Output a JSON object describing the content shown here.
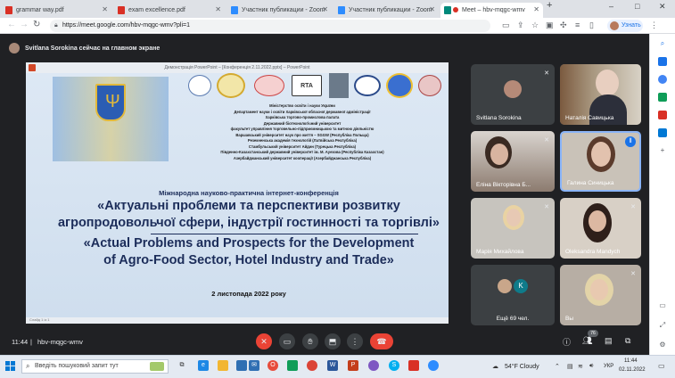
{
  "browser": {
    "tabs": [
      {
        "title": "grammar way.pdf",
        "color": "#d93025"
      },
      {
        "title": "exam excellence.pdf",
        "color": "#d93025"
      },
      {
        "title": "Участник публикации - Zoom",
        "color": "#2d8cff"
      },
      {
        "title": "Участник публикации - Zoom",
        "color": "#2d8cff"
      },
      {
        "title": "Meet – hbv-mqgc-wmv",
        "color": "#00897b"
      }
    ],
    "new_tab": "+",
    "url": "https://meet.google.com/hbv-mqgc-wmv?pli=1",
    "update_label": "Узнать",
    "window_controls": [
      "–",
      "□",
      "✕"
    ]
  },
  "meet": {
    "banner": "Svitlana Sorokina сейчас на главном экране",
    "ppt_title": "Демонстрація PowerPoint – [Конференція 2.11.2022.pptx] – PowerPoint",
    "slide_footer": "Слайд 1 із 1",
    "slide": {
      "org_lines": [
        "Міністерство освіти і науки України",
        "Департамент науки і освіти Харківської обласної державної адміністрації",
        "Харківська торгово-промислова палата",
        "Державний біотехнологічний університет",
        "факультет управління торговельно-підприємницькою та митною діяльністю",
        "Варшавський університет наук про життя – SGGW (Республіка Польща)",
        "Резекненська академія технологій (Латвійська Республіка)",
        "Стамбульський університет Айдин (Турецька Республіка)",
        "Південно-Казахстанський державний університет ім. М. Ауезова (Республіка Казахстан)",
        "Азербайджанський університет кооперації (Азербайджанська Республіка)"
      ],
      "conf_type": "Міжнародна науково-практична інтернет-конференція",
      "title_ua_1": "«Актуальні проблеми та перспективи розвитку",
      "title_ua_2": "агропродовольчої сфери, індустрії гостинності та торгівлі»",
      "title_en_1": "«Actual Problems and Prospects for the Development",
      "title_en_2": "of Agro-Food Sector, Hotel Industry and Trade»",
      "date": "2 листопада 2022 року"
    },
    "participants": [
      {
        "name": "Svitlana Sorokina"
      },
      {
        "name": "Наталія Савицька"
      },
      {
        "name": "Еліна Вікторівна Б..."
      },
      {
        "name": "Галина Синицька"
      },
      {
        "name": "Марія Михайлова"
      },
      {
        "name": "Oleksandra Mandych"
      },
      {
        "name": "Ещё 69 чел."
      },
      {
        "name": "Вы"
      }
    ],
    "others_initial": "K",
    "meeting_time": "11:44",
    "meeting_code": "hbv-mqgc-wmv",
    "people_count": "76"
  },
  "taskbar": {
    "search_placeholder": "Введіть пошуковий запит тут",
    "weather": "54°F  Cloudy",
    "lang": "УКР",
    "time": "11:44",
    "date": "02.11.2022"
  }
}
